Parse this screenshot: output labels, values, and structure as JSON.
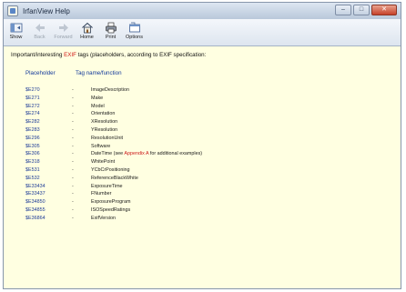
{
  "window": {
    "title": "IrfanView Help"
  },
  "toolbar": {
    "buttons": [
      {
        "label": "Show",
        "icon": "show-icon",
        "enabled": true
      },
      {
        "label": "Back",
        "icon": "back-arrow-icon",
        "enabled": false
      },
      {
        "label": "Forward",
        "icon": "forward-arrow-icon",
        "enabled": false
      },
      {
        "label": "Home",
        "icon": "home-icon",
        "enabled": true
      },
      {
        "label": "Print",
        "icon": "print-icon",
        "enabled": true
      },
      {
        "label": "Options",
        "icon": "options-icon",
        "enabled": true
      }
    ]
  },
  "content": {
    "intro_prefix": "Important/interesting",
    "intro_highlight": "EXIF",
    "intro_suffix": "tags (placeholders, according to EXIF specification:",
    "col_placeholder": "Placeholder",
    "col_tagname": "Tag name/function",
    "rows": [
      {
        "placeholder": "$E270",
        "dash": "-",
        "tag": "ImageDescription"
      },
      {
        "placeholder": "$E271",
        "dash": "-",
        "tag": "Make"
      },
      {
        "placeholder": "$E272",
        "dash": "-",
        "tag": "Model"
      },
      {
        "placeholder": "$E274",
        "dash": "-",
        "tag": "Orientation"
      },
      {
        "placeholder": "$E282",
        "dash": "-",
        "tag": "XResolution"
      },
      {
        "placeholder": "$E283",
        "dash": "-",
        "tag": "YResolution"
      },
      {
        "placeholder": "$E296",
        "dash": "-",
        "tag": "ResolutionUnit"
      },
      {
        "placeholder": "$E305",
        "dash": "-",
        "tag": "Software"
      },
      {
        "placeholder": "$E306",
        "dash": "-",
        "tag": "DateTime (see",
        "link": "Appendix A",
        "tag_after": "for additional examples)"
      },
      {
        "placeholder": "$E318",
        "dash": "-",
        "tag": "WhitePoint"
      },
      {
        "placeholder": "$E531",
        "dash": "-",
        "tag": "YCbCrPositioning"
      },
      {
        "placeholder": "$E532",
        "dash": "-",
        "tag": "ReferenceBlackWhite"
      },
      {
        "placeholder": "$E33434",
        "dash": "-",
        "tag": "ExposureTime"
      },
      {
        "placeholder": "$E33437",
        "dash": "-",
        "tag": "FNumber"
      },
      {
        "placeholder": "$E34850",
        "dash": "-",
        "tag": "ExposureProgram"
      },
      {
        "placeholder": "$E34855",
        "dash": "-",
        "tag": "ISOSpeedRatings"
      },
      {
        "placeholder": "$E36864",
        "dash": "-",
        "tag": "ExifVersion"
      }
    ]
  }
}
